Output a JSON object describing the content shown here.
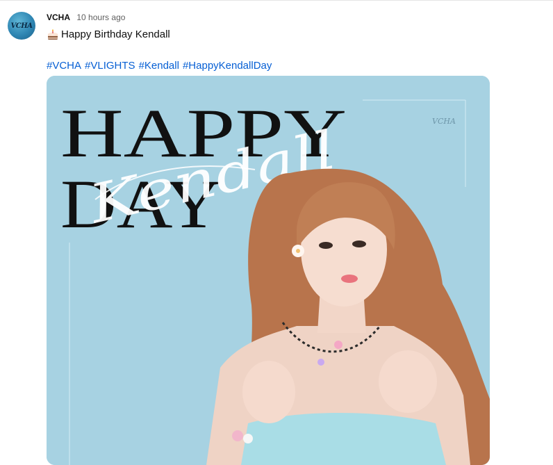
{
  "post": {
    "author": "VCHA",
    "timestamp": "10 hours ago",
    "avatar_text": "VCHA",
    "text": "Happy Birthday Kendall",
    "emoji_icon": "birthday-cake-icon",
    "hashtags": [
      "#VCHA",
      "#VLIGHTS",
      "#Kendall",
      "#HappyKendallDay"
    ]
  },
  "image": {
    "headline_top": "HAPPY",
    "headline_bottom": "DAY",
    "script_name": "Kendall",
    "logo_text": "VCHA"
  },
  "colors": {
    "hashtag": "#065fd4",
    "image_bg": "#a7d2e2",
    "headline": "#111111"
  }
}
